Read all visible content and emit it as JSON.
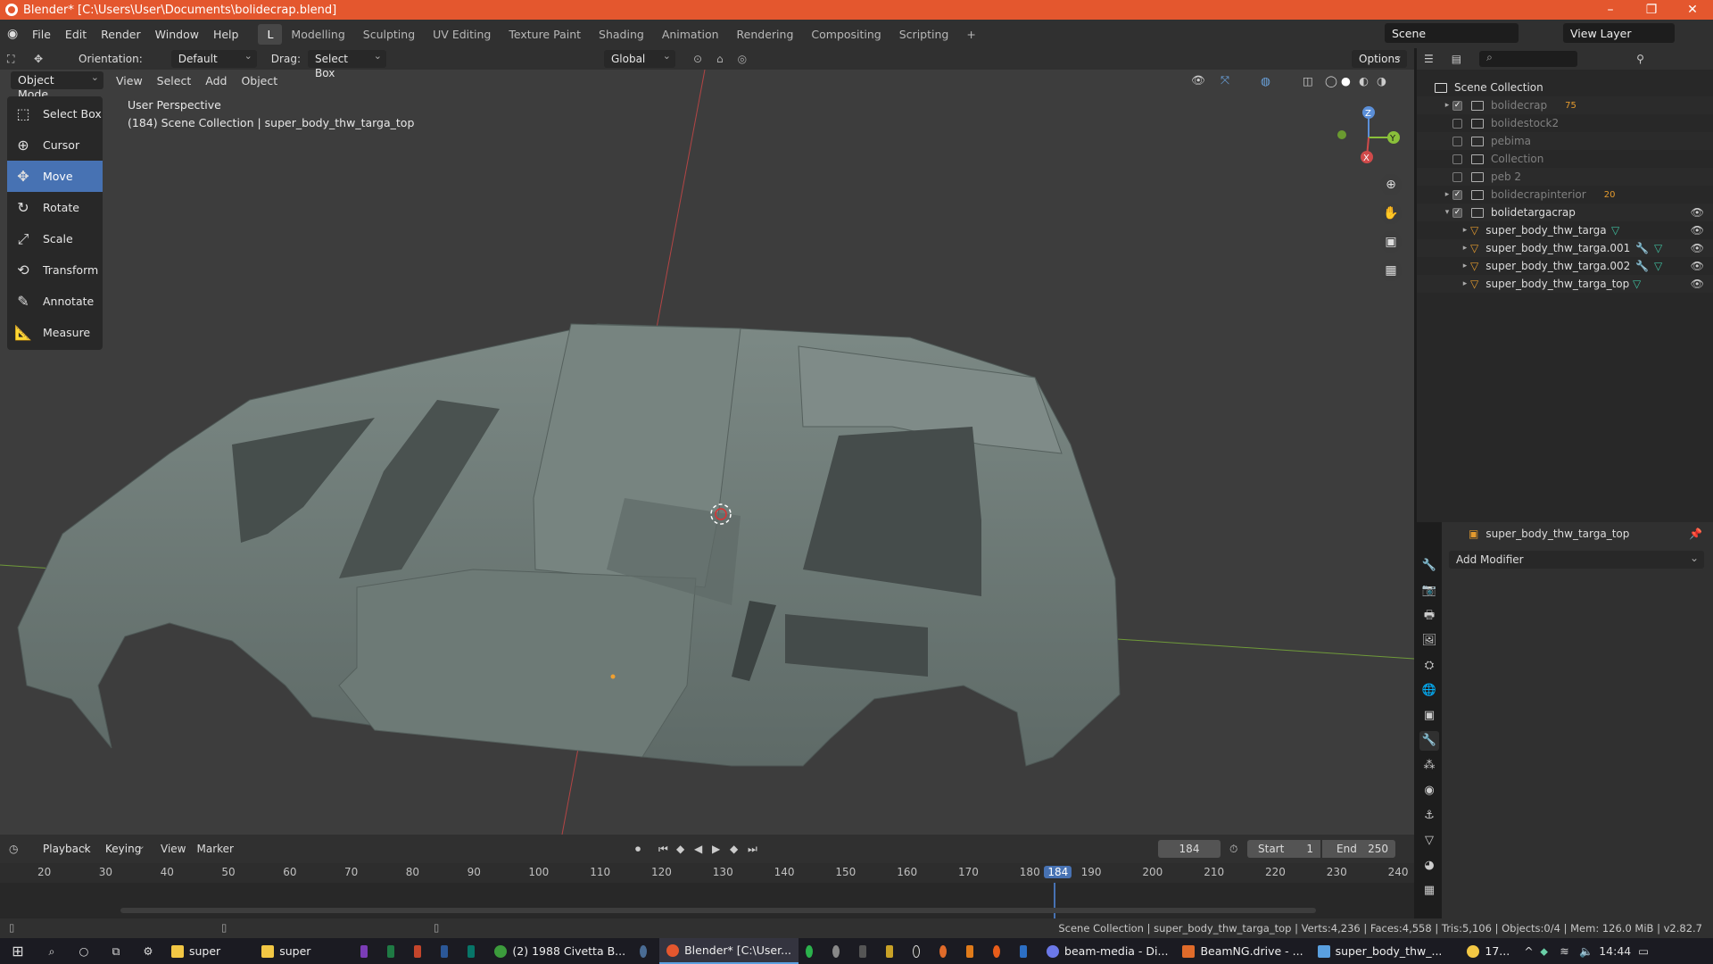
{
  "window": {
    "title": "Blender* [C:\\Users\\User\\Documents\\bolidecrap.blend]"
  },
  "menu": {
    "items": [
      "File",
      "Edit",
      "Render",
      "Window",
      "Help"
    ]
  },
  "workspaces": [
    "Layout",
    "Modelling",
    "Sculpting",
    "UV Editing",
    "Texture Paint",
    "Shading",
    "Animation",
    "Rendering",
    "Compositing",
    "Scripting"
  ],
  "workspace_active_short": "L",
  "scene": {
    "name": "Scene",
    "view_layer": "View Layer"
  },
  "header": {
    "orientation_label": "Orientation:",
    "orientation_value": "Default",
    "drag_label": "Drag:",
    "drag_value": "Select Box",
    "transform_space": "Global",
    "options": "Options"
  },
  "viewport_header": {
    "mode": "Object Mode",
    "menus": [
      "View",
      "Select",
      "Add",
      "Object"
    ]
  },
  "viewport": {
    "perspective": "User Perspective",
    "info": "(184) Scene Collection | super_body_thw_targa_top"
  },
  "tools": [
    {
      "label": "Select Box",
      "icon": "select-box-icon"
    },
    {
      "label": "Cursor",
      "icon": "cursor-icon"
    },
    {
      "label": "Move",
      "icon": "move-icon",
      "active": true
    },
    {
      "label": "Rotate",
      "icon": "rotate-icon"
    },
    {
      "label": "Scale",
      "icon": "scale-icon"
    },
    {
      "label": "Transform",
      "icon": "transform-icon"
    },
    {
      "label": "Annotate",
      "icon": "annotate-icon"
    },
    {
      "label": "Measure",
      "icon": "measure-icon"
    }
  ],
  "gizmo": {
    "z": "Z",
    "y": "Y",
    "x": "X"
  },
  "outliner": {
    "root": "Scene Collection",
    "rows": [
      {
        "label": "bolidecrap",
        "checked": true,
        "dim": true,
        "badge": "75"
      },
      {
        "label": "bolidestock2",
        "checked": false,
        "dim": true
      },
      {
        "label": "pebima",
        "checked": false,
        "dim": true
      },
      {
        "label": "Collection",
        "checked": false,
        "dim": true
      },
      {
        "label": "peb 2",
        "checked": false,
        "dim": true
      },
      {
        "label": "bolidecrapinterior",
        "checked": true,
        "dim": true,
        "badge": "20"
      },
      {
        "label": "bolidetargacrap",
        "checked": true,
        "dim": false
      },
      {
        "label": "super_body_thw_targa"
      },
      {
        "label": "super_body_thw_targa.001"
      },
      {
        "label": "super_body_thw_targa.002"
      },
      {
        "label": "super_body_thw_targa_top"
      }
    ]
  },
  "properties": {
    "object": "super_body_thw_targa_top",
    "add_modifier": "Add Modifier"
  },
  "timeline": {
    "menus": [
      "Playback",
      "Keying",
      "View",
      "Marker"
    ],
    "current_frame": "184",
    "start_label": "Start",
    "start": "1",
    "end_label": "End",
    "end": "250",
    "ticks": [
      "20",
      "30",
      "40",
      "50",
      "60",
      "70",
      "80",
      "90",
      "100",
      "110",
      "120",
      "130",
      "140",
      "150",
      "160",
      "170",
      "180",
      "184",
      "190",
      "200",
      "210",
      "220",
      "230",
      "240"
    ]
  },
  "status": {
    "text": "Scene Collection | super_body_thw_targa_top | Verts:4,236 | Faces:4,558 | Tris:5,106 | Objects:0/4 | Mem: 126.0 MiB | v2.82.7"
  },
  "taskbar": {
    "items": [
      {
        "label": "super",
        "color": "#f2c744"
      },
      {
        "label": "super",
        "color": "#f2c744"
      },
      {
        "label": "(2) 1988 Civetta B...",
        "color": "#3c9b3c"
      },
      {
        "label": "Blender* [C:\\User...",
        "color": "#e4572e",
        "active": true
      },
      {
        "label": "beam-media - Di...",
        "color": "#6b78e8"
      },
      {
        "label": "BeamNG.drive - ...",
        "color": "#e06b2a"
      },
      {
        "label": "super_body_thw_...",
        "color": "#5aa0e0"
      }
    ],
    "temp": "17...",
    "time": "14:44"
  }
}
